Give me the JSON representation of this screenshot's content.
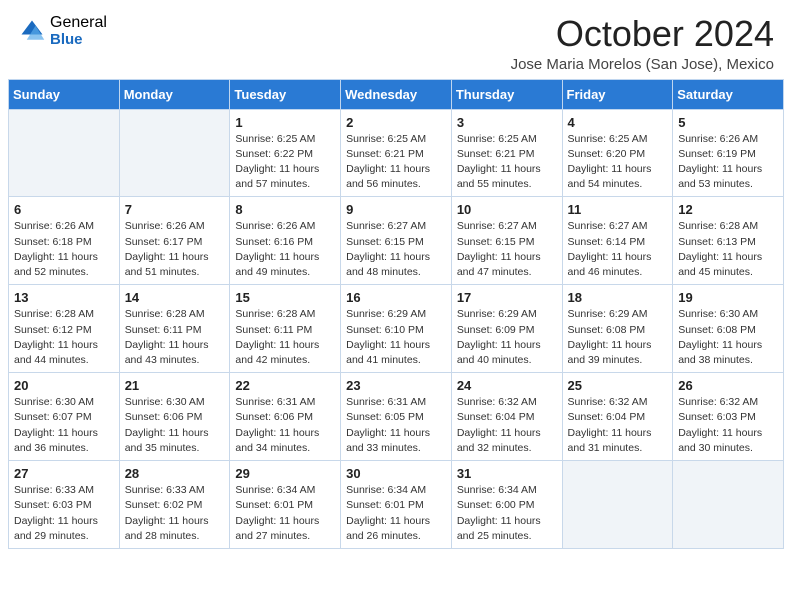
{
  "logo": {
    "general": "General",
    "blue": "Blue"
  },
  "title": "October 2024",
  "location": "Jose Maria Morelos (San Jose), Mexico",
  "days_of_week": [
    "Sunday",
    "Monday",
    "Tuesday",
    "Wednesday",
    "Thursday",
    "Friday",
    "Saturday"
  ],
  "weeks": [
    [
      {
        "day": "",
        "empty": true
      },
      {
        "day": "",
        "empty": true
      },
      {
        "day": "1",
        "sunrise": "6:25 AM",
        "sunset": "6:22 PM",
        "daylight": "11 hours and 57 minutes."
      },
      {
        "day": "2",
        "sunrise": "6:25 AM",
        "sunset": "6:21 PM",
        "daylight": "11 hours and 56 minutes."
      },
      {
        "day": "3",
        "sunrise": "6:25 AM",
        "sunset": "6:21 PM",
        "daylight": "11 hours and 55 minutes."
      },
      {
        "day": "4",
        "sunrise": "6:25 AM",
        "sunset": "6:20 PM",
        "daylight": "11 hours and 54 minutes."
      },
      {
        "day": "5",
        "sunrise": "6:26 AM",
        "sunset": "6:19 PM",
        "daylight": "11 hours and 53 minutes."
      }
    ],
    [
      {
        "day": "6",
        "sunrise": "6:26 AM",
        "sunset": "6:18 PM",
        "daylight": "11 hours and 52 minutes."
      },
      {
        "day": "7",
        "sunrise": "6:26 AM",
        "sunset": "6:17 PM",
        "daylight": "11 hours and 51 minutes."
      },
      {
        "day": "8",
        "sunrise": "6:26 AM",
        "sunset": "6:16 PM",
        "daylight": "11 hours and 49 minutes."
      },
      {
        "day": "9",
        "sunrise": "6:27 AM",
        "sunset": "6:15 PM",
        "daylight": "11 hours and 48 minutes."
      },
      {
        "day": "10",
        "sunrise": "6:27 AM",
        "sunset": "6:15 PM",
        "daylight": "11 hours and 47 minutes."
      },
      {
        "day": "11",
        "sunrise": "6:27 AM",
        "sunset": "6:14 PM",
        "daylight": "11 hours and 46 minutes."
      },
      {
        "day": "12",
        "sunrise": "6:28 AM",
        "sunset": "6:13 PM",
        "daylight": "11 hours and 45 minutes."
      }
    ],
    [
      {
        "day": "13",
        "sunrise": "6:28 AM",
        "sunset": "6:12 PM",
        "daylight": "11 hours and 44 minutes."
      },
      {
        "day": "14",
        "sunrise": "6:28 AM",
        "sunset": "6:11 PM",
        "daylight": "11 hours and 43 minutes."
      },
      {
        "day": "15",
        "sunrise": "6:28 AM",
        "sunset": "6:11 PM",
        "daylight": "11 hours and 42 minutes."
      },
      {
        "day": "16",
        "sunrise": "6:29 AM",
        "sunset": "6:10 PM",
        "daylight": "11 hours and 41 minutes."
      },
      {
        "day": "17",
        "sunrise": "6:29 AM",
        "sunset": "6:09 PM",
        "daylight": "11 hours and 40 minutes."
      },
      {
        "day": "18",
        "sunrise": "6:29 AM",
        "sunset": "6:08 PM",
        "daylight": "11 hours and 39 minutes."
      },
      {
        "day": "19",
        "sunrise": "6:30 AM",
        "sunset": "6:08 PM",
        "daylight": "11 hours and 38 minutes."
      }
    ],
    [
      {
        "day": "20",
        "sunrise": "6:30 AM",
        "sunset": "6:07 PM",
        "daylight": "11 hours and 36 minutes."
      },
      {
        "day": "21",
        "sunrise": "6:30 AM",
        "sunset": "6:06 PM",
        "daylight": "11 hours and 35 minutes."
      },
      {
        "day": "22",
        "sunrise": "6:31 AM",
        "sunset": "6:06 PM",
        "daylight": "11 hours and 34 minutes."
      },
      {
        "day": "23",
        "sunrise": "6:31 AM",
        "sunset": "6:05 PM",
        "daylight": "11 hours and 33 minutes."
      },
      {
        "day": "24",
        "sunrise": "6:32 AM",
        "sunset": "6:04 PM",
        "daylight": "11 hours and 32 minutes."
      },
      {
        "day": "25",
        "sunrise": "6:32 AM",
        "sunset": "6:04 PM",
        "daylight": "11 hours and 31 minutes."
      },
      {
        "day": "26",
        "sunrise": "6:32 AM",
        "sunset": "6:03 PM",
        "daylight": "11 hours and 30 minutes."
      }
    ],
    [
      {
        "day": "27",
        "sunrise": "6:33 AM",
        "sunset": "6:03 PM",
        "daylight": "11 hours and 29 minutes."
      },
      {
        "day": "28",
        "sunrise": "6:33 AM",
        "sunset": "6:02 PM",
        "daylight": "11 hours and 28 minutes."
      },
      {
        "day": "29",
        "sunrise": "6:34 AM",
        "sunset": "6:01 PM",
        "daylight": "11 hours and 27 minutes."
      },
      {
        "day": "30",
        "sunrise": "6:34 AM",
        "sunset": "6:01 PM",
        "daylight": "11 hours and 26 minutes."
      },
      {
        "day": "31",
        "sunrise": "6:34 AM",
        "sunset": "6:00 PM",
        "daylight": "11 hours and 25 minutes."
      },
      {
        "day": "",
        "empty": true
      },
      {
        "day": "",
        "empty": true
      }
    ]
  ]
}
